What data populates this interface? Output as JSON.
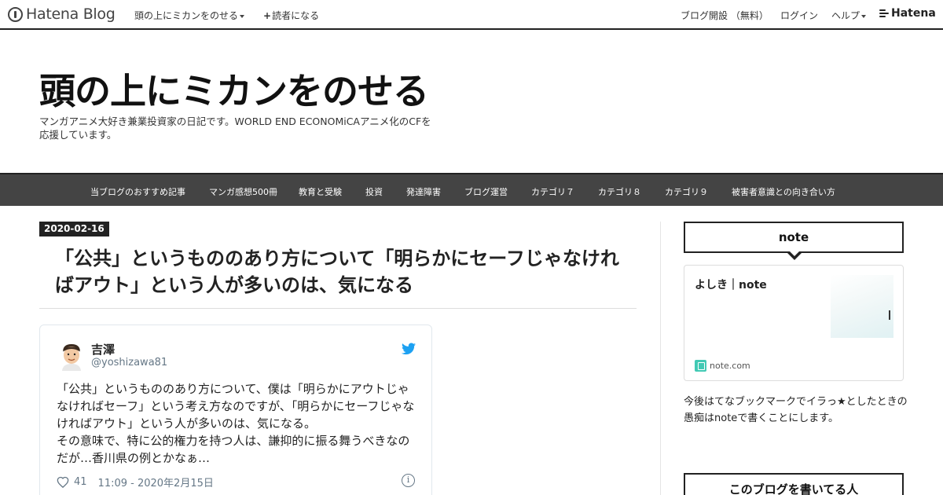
{
  "global_bar": {
    "logo_text": "Hatena Blog",
    "blog_menu_label": "頭の上にミカンをのせる",
    "subscribe_label": "読者になる",
    "open_blog_label": "ブログ開設 （無料）",
    "login_label": "ログイン",
    "help_label": "ヘルプ",
    "hatena_label": "Hatena"
  },
  "header": {
    "title": "頭の上にミカンをのせる",
    "description": "マンガアニメ大好き兼業投資家の日記です。WORLD END ECONOMiCAアニメ化のCFを応援しています。"
  },
  "category_nav": {
    "items": [
      "当ブログのおすすめ記事",
      "マンガ感想500冊",
      "教育と受験",
      "投資",
      "発達障害",
      "ブログ運営",
      "カテゴリ７",
      "カテゴリ８",
      "カテゴリ９",
      "被害者意識との向き合い方"
    ]
  },
  "entry": {
    "date": "2020-02-16",
    "title": "「公共」というもののあり方について「明らかにセーフじゃなければアウト」という人が多いのは、気になる"
  },
  "tweet": {
    "author_name": "吉澤",
    "author_handle": "@yoshizawa81",
    "text": "「公共」というもののあり方について、僕は「明らかにアウトじゃなければセーフ」という考え方なのですが、「明らかにセーフじゃなければアウト」という人が多いのは、気になる。\nその意味で、特に公的権力を持つ人は、謙抑的に振る舞うべきなのだが…香川県の例とかなぁ…",
    "like_count": "41",
    "timestamp": "11:09 - 2020年2月15日",
    "info_glyph": "i"
  },
  "sidebar": {
    "note_heading": "note",
    "note_card": {
      "title": "よしき｜note",
      "site": "note.com"
    },
    "note_text": "今後はてなブックマークでイラっ★としたときの愚痴はnoteで書くことにします。",
    "author_heading": "このブログを書いてる人"
  },
  "icons": {
    "logo": "hatena-blog-logo-icon",
    "bird": "twitter-bird-icon",
    "heart": "heart-icon",
    "info": "info-icon",
    "favicon": "note-favicon-icon"
  },
  "colors": {
    "nav_background": "#444444",
    "twitter_blue": "#1da1f2",
    "note_green": "#41c9b4"
  }
}
